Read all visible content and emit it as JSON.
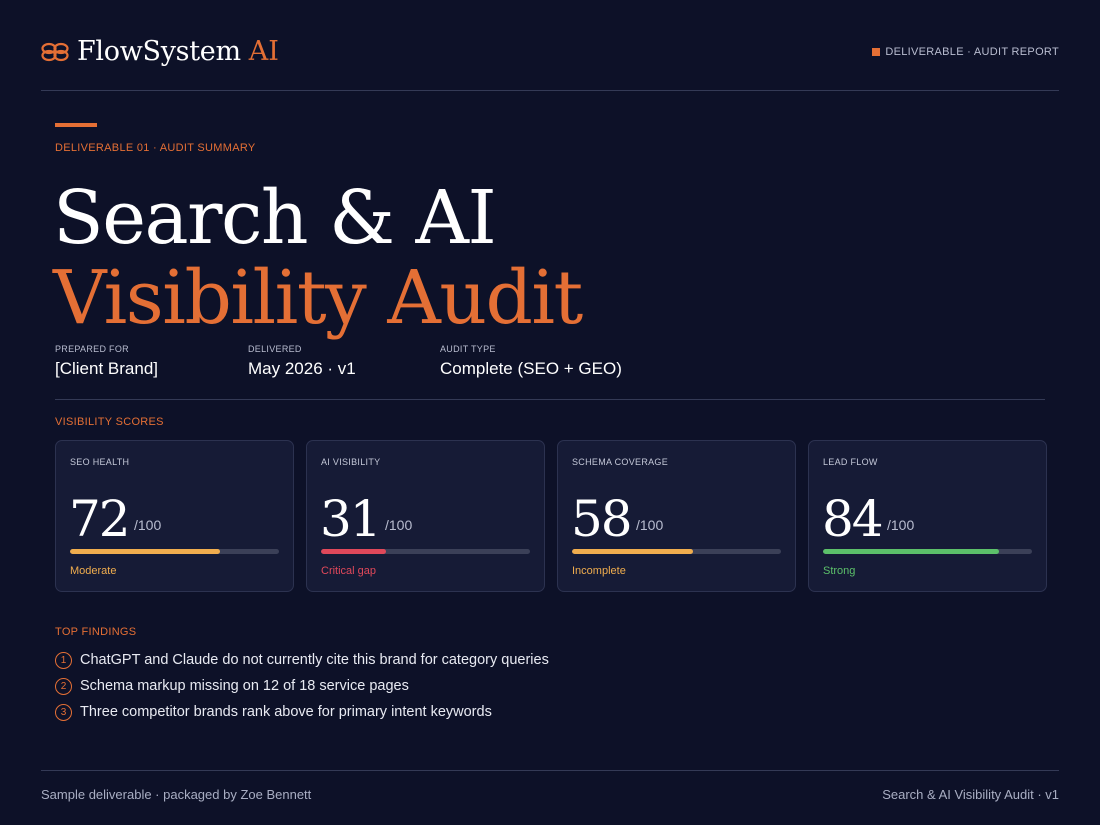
{
  "header": {
    "brand_name": "FlowSystem",
    "brand_accent": "AI",
    "tag": "DELIVERABLE · AUDIT REPORT",
    "logo_icon": "interlocking-loops-icon"
  },
  "hero": {
    "eyebrow": "DELIVERABLE 01 · AUDIT SUMMARY",
    "title_line1": "Search & AI",
    "title_line2": "Visibility Audit"
  },
  "meta": [
    {
      "label": "PREPARED FOR",
      "value": "[Client Brand]"
    },
    {
      "label": "DELIVERED",
      "value": "May 2026 · v1"
    },
    {
      "label": "AUDIT TYPE",
      "value": "Complete (SEO + GEO)"
    }
  ],
  "scores_label": "VISIBILITY SCORES",
  "scores": [
    {
      "label": "SEO HEALTH",
      "score": "72",
      "max": "/100",
      "fraction": 0.72,
      "status": "Moderate",
      "color": "#f0ad4e"
    },
    {
      "label": "AI VISIBILITY",
      "score": "31",
      "max": "/100",
      "fraction": 0.31,
      "status": "Critical gap",
      "color": "#e0485a"
    },
    {
      "label": "SCHEMA COVERAGE",
      "score": "58",
      "max": "/100",
      "fraction": 0.58,
      "status": "Incomplete",
      "color": "#f0ad4e"
    },
    {
      "label": "LEAD FLOW",
      "score": "84",
      "max": "/100",
      "fraction": 0.84,
      "status": "Strong",
      "color": "#5cc06a"
    }
  ],
  "findings_label": "TOP FINDINGS",
  "findings": [
    {
      "num": "1",
      "text": "ChatGPT and Claude do not currently cite this brand for category queries"
    },
    {
      "num": "2",
      "text": "Schema markup missing on 12 of 18 service pages"
    },
    {
      "num": "3",
      "text": "Three competitor brands rank above for primary intent keywords"
    }
  ],
  "footer": {
    "left": "Sample deliverable · packaged by Zoe Bennett",
    "right": "Search & AI Visibility Audit · v1"
  },
  "colors": {
    "background": "#0d1128",
    "accent": "#e46f35",
    "card": "#161b36"
  }
}
